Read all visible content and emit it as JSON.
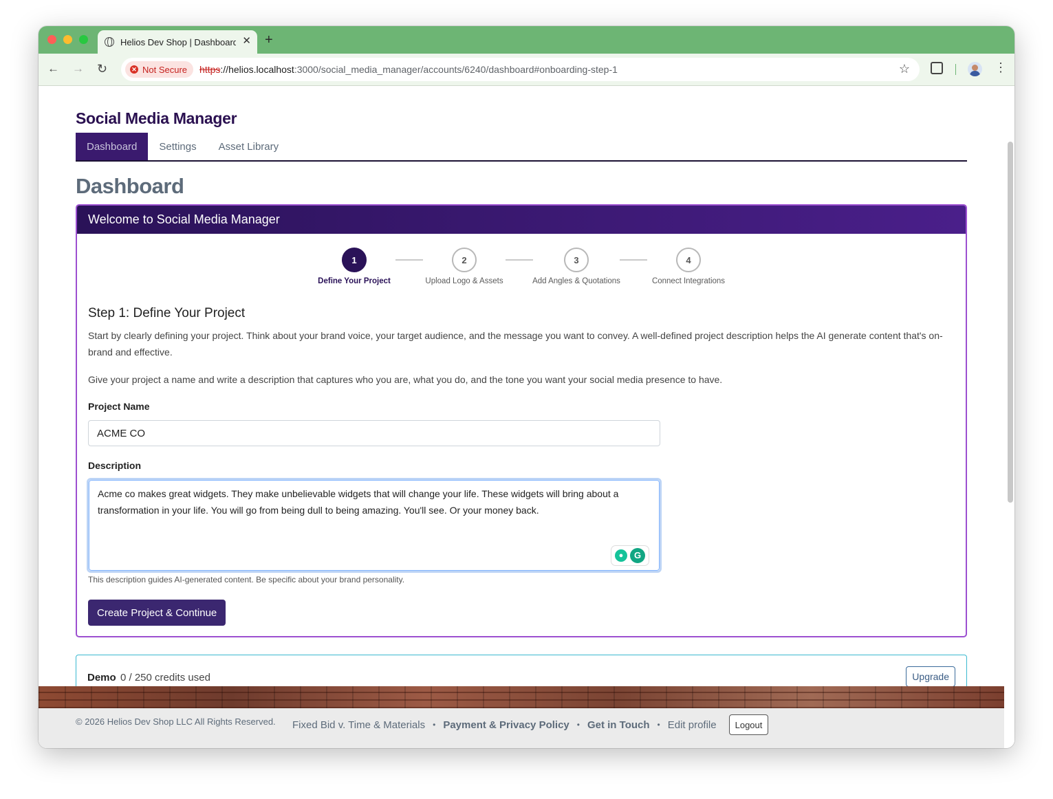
{
  "browser": {
    "tab_title": "Helios Dev Shop | Dashboard",
    "security_label": "Not Secure",
    "url_scheme": "https",
    "url_sep": "://",
    "url_host": "helios.localhost",
    "url_path": ":3000/social_media_manager/accounts/6240/dashboard#onboarding-step-1"
  },
  "app": {
    "title": "Social Media Manager",
    "nav": [
      {
        "label": "Dashboard"
      },
      {
        "label": "Settings"
      },
      {
        "label": "Asset Library"
      }
    ],
    "page_heading": "Dashboard"
  },
  "onboarding": {
    "header": "Welcome to Social Media Manager",
    "steps": [
      {
        "number": "1",
        "label": "Define Your Project"
      },
      {
        "number": "2",
        "label": "Upload Logo & Assets"
      },
      {
        "number": "3",
        "label": "Add Angles & Quotations"
      },
      {
        "number": "4",
        "label": "Connect Integrations"
      }
    ],
    "active_step": 1,
    "step_title": "Step 1: Define Your Project",
    "intro": "Start by clearly defining your project. Think about your brand voice, your target audience, and the message you want to convey. A well-defined project description helps the AI generate content that's on-brand and effective.",
    "instruction": "Give your project a name and write a description that captures who you are, what you do, and the tone you want your social media presence to have.",
    "project_name_label": "Project Name",
    "project_name_value": "ACME CO",
    "description_label": "Description",
    "description_value": "Acme co makes great widgets. They make unbelievable widgets that will change your life. These widgets will bring about a transformation in your life. You will go from being dull to being amazing. You'll see. Or your money back.",
    "description_help": "This description guides AI-generated content. Be specific about your brand personality.",
    "submit_label": "Create Project & Continue"
  },
  "plan": {
    "name": "Demo",
    "usage": "0 / 250 credits used",
    "upgrade_label": "Upgrade"
  },
  "footer": {
    "copyright": "© 2026 Helios Dev Shop LLC All Rights Reserved.",
    "links": [
      {
        "label": "Fixed Bid v. Time & Materials"
      },
      {
        "label": "Payment & Privacy Policy"
      },
      {
        "label": "Get in Touch"
      },
      {
        "label": "Edit profile"
      }
    ],
    "separator": "•",
    "logout_label": "Logout"
  },
  "colors": {
    "brand_dark": "#2a1258",
    "accent_border": "#9c4fd0",
    "chrome_green": "#6db574"
  }
}
